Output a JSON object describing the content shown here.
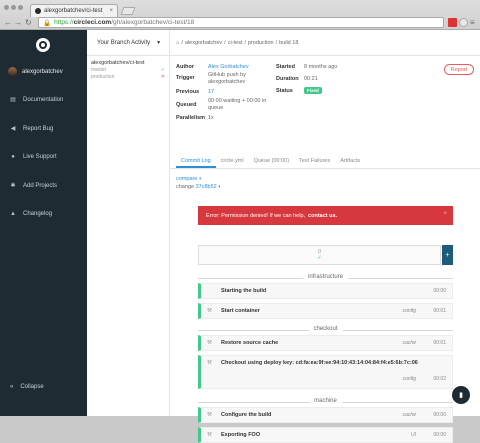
{
  "browser": {
    "tab_title": "alexgorbatchev/ci-test",
    "url_scheme": "https://",
    "url_host": "circleci.com",
    "url_path": "/gh/alexgorbatchev/ci-test/18"
  },
  "sidebar": {
    "username": "alexgorbatchev",
    "items": [
      {
        "label": "Documentation",
        "icon": "book-icon"
      },
      {
        "label": "Report Bug",
        "icon": "megaphone-icon"
      },
      {
        "label": "Live Support",
        "icon": "chat-icon"
      },
      {
        "label": "Add Projects",
        "icon": "gear-icon"
      },
      {
        "label": "Changelog",
        "icon": "bell-icon"
      }
    ],
    "collapse_label": "Collapse"
  },
  "branches": {
    "selector_label": "Your Branch Activity",
    "repo": "alexgorbatchev/ci-test",
    "rows": [
      {
        "name": "master",
        "status": "✓"
      },
      {
        "name": "production",
        "status": "✕"
      }
    ]
  },
  "breadcrumb": {
    "home": "⌂",
    "user": "alexgorbatchev",
    "repo": "ci-test",
    "branch": "production",
    "build": "build 18"
  },
  "build_info": {
    "author_label": "Author",
    "author": "Alex Gorbatchev",
    "trigger_label": "Trigger",
    "trigger_line1": "GitHub push by",
    "trigger_line2": "alexgorbatchev",
    "previous_label": "Previous",
    "previous": "17",
    "queued_label": "Queued",
    "queued_line1": "00:00 waiting + 00:00 in",
    "queued_line2": "queue",
    "parallelism_label": "Parallelism",
    "parallelism": "1x",
    "started_label": "Started",
    "started": "8 months ago",
    "duration_label": "Duration",
    "duration": "00:21",
    "status_label": "Status",
    "status": "Fixed",
    "report_label": "Report"
  },
  "tabs": [
    "Commit Log",
    "circle.yml",
    "Queue (00:00)",
    "Test Failures",
    "Artifacts"
  ],
  "commit": {
    "compare": "compare",
    "change_prefix": "change",
    "change_hash": "37c8b52"
  },
  "error": {
    "text": "Error: Permission denied! If we can help,",
    "link": "contact us.",
    "close": "×"
  },
  "composer": {
    "count": "0",
    "check": "✓",
    "plus": "+"
  },
  "sections": [
    {
      "title": "infrastructure"
    },
    {
      "title": "checkout"
    },
    {
      "title": "machine"
    }
  ],
  "steps": [
    {
      "name": "Starting the build",
      "cmd": "",
      "time": "00:00"
    },
    {
      "name": "Start container",
      "cmd": "config",
      "time": "00:01"
    },
    {
      "name": "Restore source cache",
      "cmd": "cache",
      "time": "00:01"
    },
    {
      "name": "Checkout using deploy key: cd:fa:ea:9f:ee:94:10:43:14:04:84:f4:e5:6b:7c:06",
      "cmd": "config",
      "time": "00:02"
    },
    {
      "name": "Configure the build",
      "cmd": "cache",
      "time": "00:00"
    },
    {
      "name": "Exporting FOO",
      "cmd": "UI",
      "time": "00:00"
    }
  ],
  "colors": {
    "sidebar_bg": "#1e2b33",
    "success": "#42c88a",
    "error": "#d7383e",
    "link": "#2c8fd6"
  }
}
